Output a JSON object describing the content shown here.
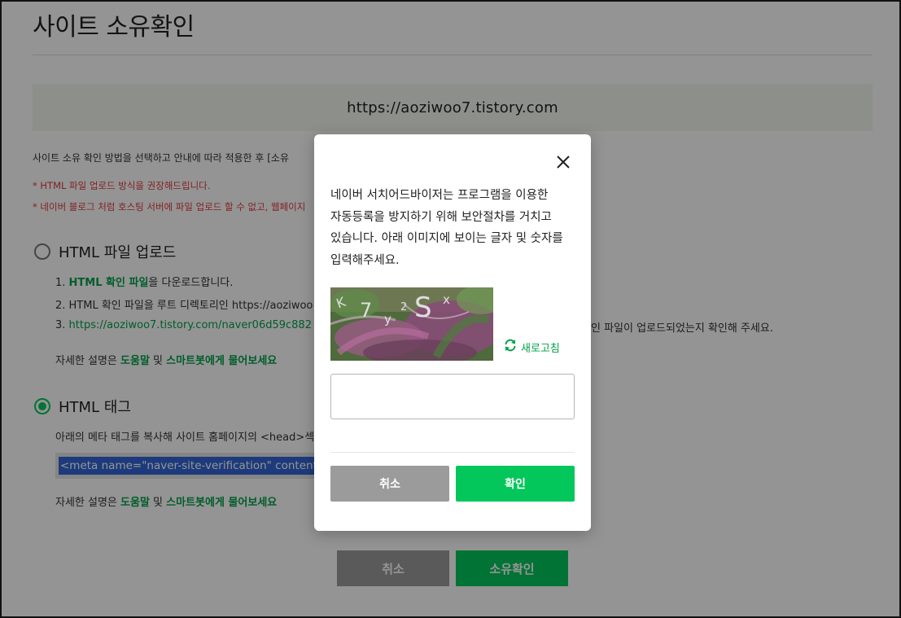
{
  "page": {
    "title": "사이트 소유확인",
    "site_url": "https://aoziwoo7.tistory.com",
    "description": "사이트 소유 확인 방법을 선택하고 안내에 따라 적용한 후 [소유",
    "warnings": [
      "* HTML 파일 업로드 방식을 권장해드립니다.",
      "* 네이버 블로그 처럼 호스팅 서버에 파일 업로드 할 수 없고, 웹페이지"
    ]
  },
  "option_file": {
    "label": "HTML 파일 업로드",
    "selected": false,
    "step1_prefix": "1. ",
    "step1_link": "HTML 확인 파일",
    "step1_suffix": "을 다운로드합니다.",
    "step2": "2. HTML 확인 파일을 루트 디렉토리인 https://aoziwoo",
    "step3_prefix": "3. ",
    "step3_link": "https://aoziwoo7.tistory.com/naver06d59c882",
    "step3_tail": "인 파일이 업로드되었는지 확인해 주세요.",
    "help_prefix": "자세한 설명은 ",
    "help_link1": "도움말",
    "help_mid": " 및 ",
    "help_link2": "스마트봇에게 물어보세요"
  },
  "option_tag": {
    "label": "HTML 태그",
    "selected": true,
    "desc": "아래의 메타 태그를 복사해 사이트 홈페이지의 <head>섹션",
    "meta_code": "<meta name=\"naver-site-verification\" content=\"a",
    "help_prefix": "자세한 설명은 ",
    "help_link1": "도움말",
    "help_mid": " 및 ",
    "help_link2": "스마트봇에게 물어보세요"
  },
  "bottom_buttons": {
    "cancel": "취소",
    "confirm": "소유확인"
  },
  "modal": {
    "message": "네이버 서치어드바이저는 프로그램을 이용한 자동등록을 방지하기 위해 보안절차를 거치고 있습니다. 아래 이미지에 보이는 글자 및 숫자를 입력해주세요.",
    "captcha_text": "K7y2Sx",
    "refresh_label": "새로고침",
    "input_value": "",
    "input_placeholder": "",
    "cancel": "취소",
    "confirm": "확인"
  },
  "colors": {
    "accent": "#03c75a",
    "link_green": "#03a14a",
    "warning_red": "#e0393e",
    "banner_bg": "#f1f7ee",
    "neutral_button": "#9b9b9b"
  },
  "icons": {
    "close": "close-icon",
    "refresh": "refresh-icon"
  }
}
